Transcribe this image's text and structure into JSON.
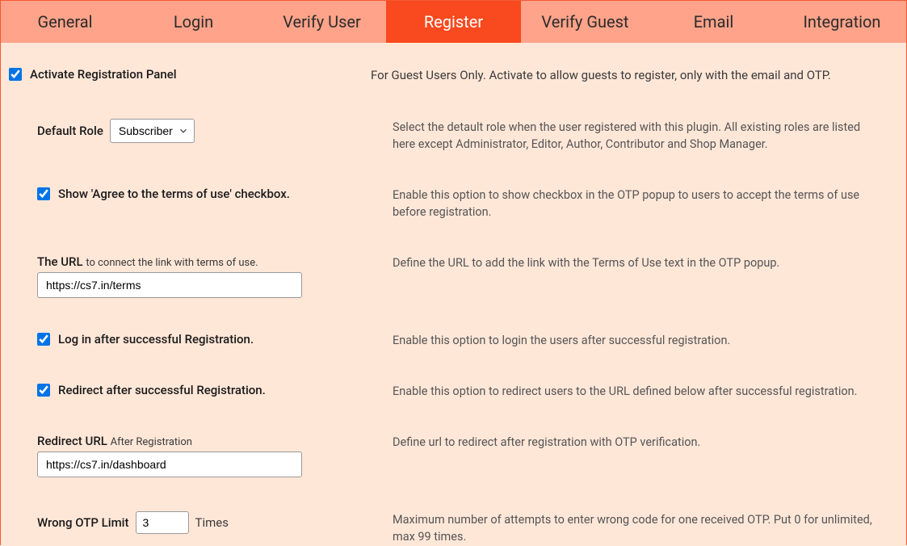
{
  "tabs": [
    {
      "label": "General",
      "active": false
    },
    {
      "label": "Login",
      "active": false
    },
    {
      "label": "Verify User",
      "active": false
    },
    {
      "label": "Register",
      "active": true
    },
    {
      "label": "Verify Guest",
      "active": false
    },
    {
      "label": "Email",
      "active": false
    },
    {
      "label": "Integration",
      "active": false
    }
  ],
  "settings": {
    "activate": {
      "label": "Activate Registration Panel",
      "desc": "For Guest Users Only. Activate to allow guests to register, only with the email and OTP.",
      "checked": true
    },
    "default_role": {
      "label": "Default Role",
      "value": "Subscriber",
      "desc": "Select the detault role when the user registered with this plugin. All existing roles are listed here except Administrator, Editor, Author, Contributor and Shop Manager."
    },
    "agree_terms": {
      "label": "Show 'Agree to the terms of use' checkbox.",
      "desc": "Enable this option to show checkbox in the OTP popup to users to accept the terms of use before registration.",
      "checked": true
    },
    "terms_url": {
      "label_main": "The URL",
      "label_sub": "to connect the link with terms of use.",
      "value": "https://cs7.in/terms",
      "desc": "Define the URL to add the link with the Terms of Use text in the OTP popup."
    },
    "login_after": {
      "label": "Log in after successful Registration.",
      "desc": "Enable this option to login the users after successful registration.",
      "checked": true
    },
    "redirect_after": {
      "label": "Redirect after successful Registration.",
      "desc": "Enable this option to redirect users to the URL defined below after successful registration.",
      "checked": true
    },
    "redirect_url": {
      "label_main": "Redirect URL",
      "label_sub": "After Registration",
      "value": "https://cs7.in/dashboard",
      "desc": "Define url to redirect after registration with OTP verification."
    },
    "wrong_otp": {
      "label": "Wrong OTP Limit",
      "suffix": "Times",
      "value": "3",
      "desc": "Maximum number of attempts to enter wrong code for one received OTP. Put 0 for unlimited, max 99 times."
    }
  }
}
